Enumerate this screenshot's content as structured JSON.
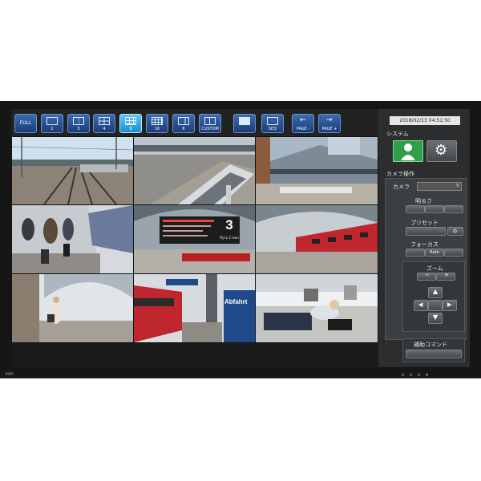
{
  "toolbar": {
    "buttons": [
      {
        "label": "FULL"
      },
      {
        "label": "1"
      },
      {
        "label": "3"
      },
      {
        "label": "4"
      },
      {
        "label": "9",
        "selected": true
      },
      {
        "label": "16"
      },
      {
        "label": "8"
      },
      {
        "label": "CUSTOM"
      },
      {
        "label": ""
      },
      {
        "label": "SEQ"
      },
      {
        "label": "PAGE -"
      },
      {
        "label": "PAGE +"
      }
    ]
  },
  "panel": {
    "datetime": "2018/02/13 04:51:50",
    "system_label": "システム",
    "camera_ops_label": "カメラ操作",
    "camera_label": "カメラ",
    "brightness_label": "明るさ",
    "preset_label": "プリセット",
    "focus_label": "フォーカス",
    "focus_auto_label": "Auto",
    "zoom_label": "ズーム",
    "aux_command_label": "補助コマンド"
  },
  "platform_sign": {
    "number": "3",
    "text": "Путь 1 Ivan"
  },
  "station_sign": {
    "text": "Abfahrt"
  },
  "brand": "EIZO",
  "colors": {
    "accent": "#1b8fd2",
    "toolbar_button": "#2a5296",
    "panel_bg": "#2b2d2f",
    "system_green": "#2f9f4a"
  }
}
